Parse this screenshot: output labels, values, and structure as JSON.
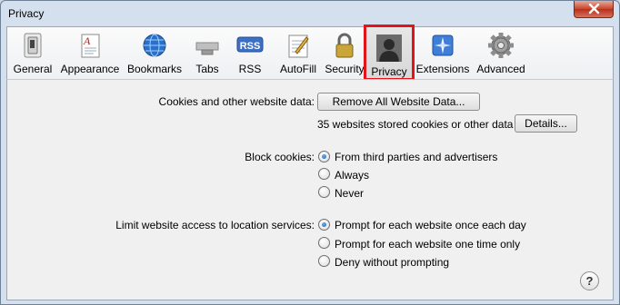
{
  "window": {
    "title": "Privacy"
  },
  "toolbar": {
    "items": [
      {
        "label": "General",
        "icon": "switch-icon"
      },
      {
        "label": "Appearance",
        "icon": "font-document-icon"
      },
      {
        "label": "Bookmarks",
        "icon": "globe-icon"
      },
      {
        "label": "Tabs",
        "icon": "tabs-icon"
      },
      {
        "label": "RSS",
        "icon": "rss-icon"
      },
      {
        "label": "AutoFill",
        "icon": "pencil-form-icon"
      },
      {
        "label": "Security",
        "icon": "lock-icon"
      },
      {
        "label": "Privacy",
        "icon": "person-silhouette-icon",
        "selected": true
      },
      {
        "label": "Extensions",
        "icon": "puzzle-compass-icon"
      },
      {
        "label": "Advanced",
        "icon": "gear-icon"
      }
    ],
    "highlight_color": "#e3131a"
  },
  "cookies": {
    "label": "Cookies and other website data:",
    "remove_button": "Remove All Website Data...",
    "summary": "35 websites stored cookies or other data",
    "details_button": "Details..."
  },
  "block_cookies": {
    "label": "Block cookies:",
    "options": [
      {
        "label": "From third parties and advertisers",
        "checked": true
      },
      {
        "label": "Always",
        "checked": false
      },
      {
        "label": "Never",
        "checked": false
      }
    ]
  },
  "location": {
    "label": "Limit website access to location services:",
    "options": [
      {
        "label": "Prompt for each website once each day",
        "checked": true
      },
      {
        "label": "Prompt for each website one time only",
        "checked": false
      },
      {
        "label": "Deny without prompting",
        "checked": false
      }
    ]
  },
  "help": {
    "symbol": "?"
  }
}
